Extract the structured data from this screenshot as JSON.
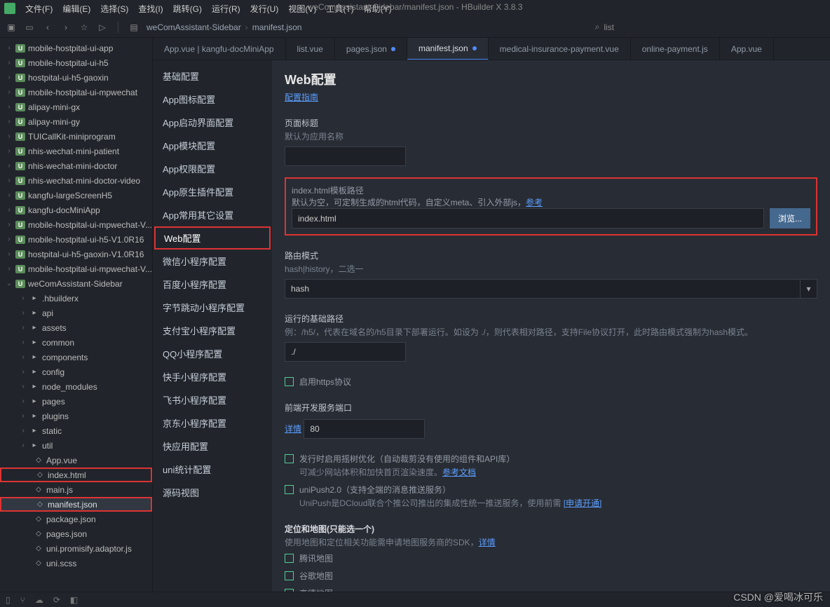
{
  "menu": [
    "文件(F)",
    "编辑(E)",
    "选择(S)",
    "查找(I)",
    "跳转(G)",
    "运行(R)",
    "发行(U)",
    "视图(V)",
    "工具(T)",
    "帮助(Y)"
  ],
  "title": {
    "path": "weComAssistant-Sidebar/manifest.json",
    "app": "HBuilder X 3.8.3"
  },
  "breadcrumb": {
    "folder": "weComAssistant-Sidebar",
    "file": "manifest.json"
  },
  "search_placeholder": "list",
  "tree": {
    "projects": [
      "mobile-hostpital-ui-app",
      "mobile-hostpital-ui-h5",
      "hostpital-ui-h5-gaoxin",
      "mobile-hostpital-ui-mpwechat",
      "alipay-mini-gx",
      "alipay-mini-gy",
      "TUICallKit-miniprogram",
      "nhis-wechat-mini-patient",
      "nhis-wechat-mini-doctor",
      "nhis-wechat-mini-doctor-video",
      "kangfu-largeScreenH5",
      "kangfu-docMiniApp",
      "mobile-hostpital-ui-mpwechat-V...",
      "mobile-hostpital-ui-h5-V1.0R16",
      "hostpital-ui-h5-gaoxin-V1.0R16",
      "mobile-hostpital-ui-mpwechat-V..."
    ],
    "open_project": "weComAssistant-Sidebar",
    "folders": [
      ".hbuilderx",
      "api",
      "assets",
      "common",
      "components",
      "config",
      "node_modules",
      "pages",
      "plugins",
      "static",
      "util"
    ],
    "files": [
      "App.vue",
      "index.html",
      "main.js",
      "manifest.json",
      "package.json",
      "pages.json",
      "uni.promisify.adaptor.js",
      "uni.scss"
    ]
  },
  "tabs": [
    "App.vue | kangfu-docMiniApp",
    "list.vue",
    "pages.json",
    "manifest.json",
    "medical-insurance-payment.vue",
    "online-payment.js",
    "App.vue"
  ],
  "active_tab": "manifest.json",
  "cfg_nav": [
    "基础配置",
    "App图标配置",
    "App启动界面配置",
    "App模块配置",
    "App权限配置",
    "App原生插件配置",
    "App常用其它设置",
    "Web配置",
    "微信小程序配置",
    "百度小程序配置",
    "字节跳动小程序配置",
    "支付宝小程序配置",
    "QQ小程序配置",
    "快手小程序配置",
    "飞书小程序配置",
    "京东小程序配置",
    "快应用配置",
    "uni统计配置",
    "源码视图"
  ],
  "cfg_active": "Web配置",
  "form": {
    "heading": "Web配置",
    "guide_link": "配置指南",
    "page_title": {
      "label": "页面标题",
      "desc": "默认为应用名称",
      "value": ""
    },
    "template": {
      "label": "index.html模板路径",
      "desc": "默认为空，可定制生成的html代码，自定义meta、引入外部js，",
      "ref": "参考",
      "value": "index.html",
      "browse": "浏览..."
    },
    "router": {
      "label": "路由模式",
      "desc": "hash|history，二选一",
      "value": "hash"
    },
    "base": {
      "label": "运行的基础路径",
      "desc": "例：/h5/，代表在域名的/h5目录下部署运行。如设为 ./，则代表相对路径，支持File协议打开，此时路由模式强制为hash模式。",
      "value": "./"
    },
    "https_label": "启用https协议",
    "dev_port": {
      "label": "前端开发服务端口",
      "link": "详情",
      "value": "80"
    },
    "treeshake": {
      "label": "发行时启用摇树优化（自动裁剪没有使用的组件和API库）",
      "desc": "可减少网站体积和加快首页渲染速度。",
      "link": "参考文档"
    },
    "unipush": {
      "label": "uniPush2.0（支持全端的消息推送服务）",
      "desc": "UniPush是DCloud联合个推公司推出的集成性统一推送服务，使用前需 ",
      "link": "[申请开通]"
    },
    "map_heading": "定位和地图(只能选一个)",
    "map_desc": "使用地图和定位相关功能需申请地图服务商的SDK，",
    "map_link": "详情",
    "maps": [
      "腾讯地图",
      "谷歌地图",
      "高德地图"
    ]
  },
  "watermark": "CSDN @爱喝冰可乐"
}
